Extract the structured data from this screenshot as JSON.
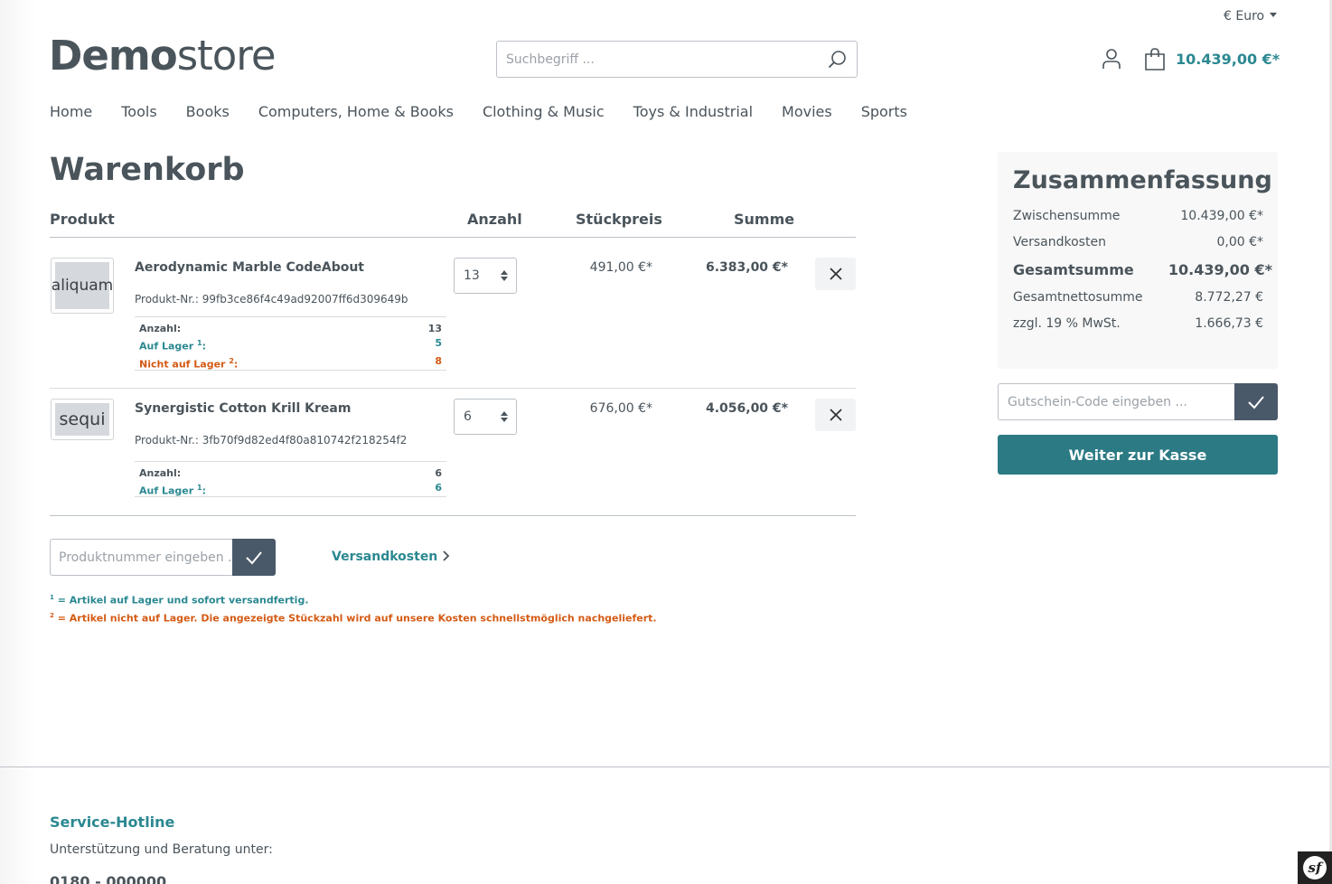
{
  "header": {
    "currency": "€ Euro",
    "logo_bold": "Demo",
    "logo_light": "store",
    "search_placeholder": "Suchbegriff ...",
    "cart_total": "10.439,00 €*"
  },
  "nav": [
    "Home",
    "Tools",
    "Books",
    "Computers, Home & Books",
    "Clothing & Music",
    "Toys & Industrial",
    "Movies",
    "Sports"
  ],
  "page_title": "Warenkorb",
  "cart": {
    "columns": {
      "product": "Produkt",
      "qty": "Anzahl",
      "unit_price": "Stückpreis",
      "total": "Summe"
    },
    "items": [
      {
        "thumb_text": "aliquam",
        "name": "Aerodynamic Marble CodeAbout",
        "product_number": "Produkt-Nr.: 99fb3ce86f4c49ad92007ff6d309649b",
        "qty": "13",
        "unit_price": "491,00 €*",
        "total": "6.383,00 €*",
        "stock": {
          "qty_label": "Anzahl:",
          "qty_value": "13",
          "in_stock_label": "Auf Lager",
          "in_stock_sup": "1",
          "in_stock_value": "5",
          "out_stock_label": "Nicht auf Lager",
          "out_stock_sup": "2",
          "out_stock_value": "8"
        }
      },
      {
        "thumb_text": "sequi",
        "name": "Synergistic Cotton Krill Kream",
        "product_number": "Produkt-Nr.: 3fb70f9d82ed4f80a810742f218254f2",
        "qty": "6",
        "unit_price": "676,00 €*",
        "total": "4.056,00 €*",
        "stock": {
          "qty_label": "Anzahl:",
          "qty_value": "6",
          "in_stock_label": "Auf Lager",
          "in_stock_sup": "1",
          "in_stock_value": "6"
        }
      }
    ],
    "add_product_placeholder": "Produktnummer eingeben ...",
    "shipping_link": "Versandkosten"
  },
  "footnotes": {
    "fn1_sup": "1",
    "fn1_text": " = Artikel auf Lager und sofort versandfertig.",
    "fn2_sup": "2",
    "fn2_text": " = Artikel nicht auf Lager. Die angezeigte Stückzahl wird auf unsere Kosten schnellstmöglich nachgeliefert."
  },
  "summary": {
    "title": "Zusammenfassung",
    "rows": [
      {
        "label": "Zwischensumme",
        "value": "10.439,00 €*"
      },
      {
        "label": "Versandkosten",
        "value": "0,00 €*"
      },
      {
        "label": "Gesamtsumme",
        "value": "10.439,00 €*"
      },
      {
        "label": "Gesamtnettosumme",
        "value": "8.772,27 €"
      },
      {
        "label": "zzgl. 19 % MwSt.",
        "value": "1.666,73 €"
      }
    ],
    "voucher_placeholder": "Gutschein-Code eingeben ...",
    "checkout_label": "Weiter zur Kasse"
  },
  "footer": {
    "hotline_title": "Service-Hotline",
    "hotline_text": "Unterstützung und Beratung unter:",
    "hotline_phone": "0180 - 000000"
  },
  "colors": {
    "accent": "#2b8891",
    "checkout": "#2b7a84",
    "text": "#4a545b",
    "warning": "#d45a14",
    "check_button": "#4a5969"
  },
  "icons": {
    "search": "search-icon",
    "account": "user-icon",
    "cart": "shopping-bag-icon",
    "remove": "close-icon",
    "confirm": "checkmark-icon",
    "chevron": "chevron-right-icon",
    "debug": "symfony-icon"
  }
}
